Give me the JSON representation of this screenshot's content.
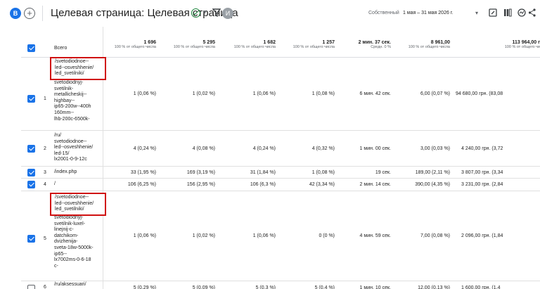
{
  "topbar": {
    "badge": "B",
    "add": "+",
    "title": "Целевая страница: Целевая страница",
    "avatar": "И",
    "compare_label": "Собственный",
    "date_range": "1 мая – 31 мая 2026 г."
  },
  "table": {
    "header_label": "Всего",
    "totals": [
      {
        "total": "1 696",
        "pct": "100 % от общего числа"
      },
      {
        "total": "5 295",
        "pct": "100 % от общего числа"
      },
      {
        "total": "1 682",
        "pct": "100 % от общего числа"
      },
      {
        "total": "1 257",
        "pct": "100 % от общего числа"
      },
      {
        "total": "2 мин. 37 сек.",
        "pct": "Средн. 0 %"
      },
      {
        "total": "8 961,00",
        "pct": "100 % от общего числа"
      },
      {
        "total": "113 964,00 г",
        "pct": "100 % от общего чи"
      }
    ],
    "rows": [
      {
        "idx": "1",
        "path": "svetodiodnyj-\nsvetilnik-\nmetallicheskij--\nhighbay--\nip65-200w--400h\n160mm--\nlhb-200c-6500k-",
        "highlight": "/svetodiodnoe--\nled--osveshhenie/\nled_svetilniki/",
        "values": [
          "1 (0,06 %)",
          "1 (0,02 %)",
          "1 (0,06 %)",
          "1 (0,08 %)",
          "6 мин. 42 сек.",
          "6,00 (0,07 %)",
          "94 680,00 грн. (83,08"
        ]
      },
      {
        "idx": "2",
        "path": "/ru/\nsvetodiodnoe--\nled--osveshhenie/\nled-15/\nlx2001-0-9-12c",
        "highlight": "",
        "values": [
          "4 (0,24 %)",
          "4 (0,08 %)",
          "4 (0,24 %)",
          "4 (0,32 %)",
          "1 мин. 00 сек.",
          "3,00 (0,03 %)",
          "4 240,00 грн. (3,72"
        ]
      },
      {
        "idx": "3",
        "path": "/index.php",
        "highlight": "",
        "values": [
          "33 (1,95 %)",
          "169 (3,19 %)",
          "31 (1,84 %)",
          "1 (0,08 %)",
          "19 сек.",
          "189,00 (2,11 %)",
          "3 807,00 грн. (3,34"
        ]
      },
      {
        "idx": "4",
        "path": "/",
        "highlight": "",
        "values": [
          "106 (6,25 %)",
          "156 (2,95 %)",
          "106 (6,3 %)",
          "42 (3,34 %)",
          "2 мин. 14 сек.",
          "390,00 (4,35 %)",
          "3 231,00 грн. (2,84"
        ]
      },
      {
        "idx": "5",
        "path": "svetodiodnyj-\nsvetilnik-luxel-\nlinejnij-c-\ndatchikom-\ndvizhenija-\nsveta-18w-5000k-\nip65--\nlx7002ms-0-6-18\nc-",
        "highlight": "/svetodiodnoe--\nled--osveshhenie/\nled_svetilniki/",
        "values": [
          "1 (0,06 %)",
          "1 (0,02 %)",
          "1 (0,06 %)",
          "0 (0 %)",
          "4 мин. 59 сек.",
          "7,00 (0,08 %)",
          "2 096,00 грн. (1,84"
        ]
      },
      {
        "idx": "6",
        "path": "/ru/aksessuari/",
        "highlight": "",
        "values": [
          "5 (0,29 %)",
          "5 (0,09 %)",
          "5 (0,3 %)",
          "5 (0,4 %)",
          "1 мин. 10 сек.",
          "12,00 (0,13 %)",
          "1 600,00 грн. (1,4"
        ]
      }
    ]
  }
}
